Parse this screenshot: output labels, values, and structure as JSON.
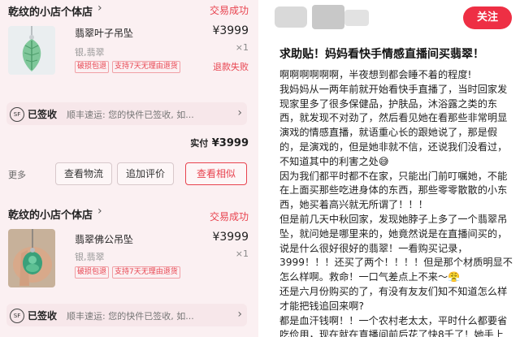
{
  "left_panel": {
    "orders": [
      {
        "shop_name": "乾纹的小店个体店",
        "status": "交易成功",
        "product_title": "翡翠叶子吊坠",
        "price": "¥3999",
        "qty": "×1",
        "spec": "银,翡翠",
        "badges": [
          "破损包退",
          "支持7天无理由退货"
        ],
        "refund_status": "退款失败",
        "logistics": {
          "icon": "SF",
          "signed_label": "已签收",
          "text": "顺丰速运: 您的快件已签收, 如..."
        },
        "paid_label": "实付",
        "paid_value": "¥3999",
        "more_label": "更多",
        "buttons": [
          "查看物流",
          "追加评价",
          "查看相似"
        ]
      },
      {
        "shop_name": "乾纹的小店个体店",
        "status": "交易成功",
        "product_title": "翡翠佛公吊坠",
        "price": "¥3999",
        "qty": "×1",
        "spec": "银,翡翠",
        "badges": [
          "破损包退",
          "支持7天无理由退货"
        ],
        "logistics": {
          "icon": "SF",
          "signed_label": "已签收",
          "text": "顺丰速运: 您的快件已签收, 如..."
        }
      }
    ]
  },
  "right_panel": {
    "follow_label": "关注",
    "post_title": "求助贴！妈妈看快手情感直播间买翡翠！",
    "paragraphs": [
      "啊啊啊啊啊啊，半夜想到都会睡不着的程度!",
      "我妈妈从一两年前就开始看快手直播了，当时回家发现家里多了很多保健品，护肤品，沐浴露之类的东西，就发现不对劲了，然后看见她在看那些非常明显演戏的情感直播，就语重心长的跟她说了，那是假的，是演戏的，但是她非就不信，还说我们没看过，不知道其中的利害之处",
      "因为我们都平时都不在家，只能出门前叮嘱她，不能在上面买那些吃进身体的东西，那些零零散散的小东西，她买着高兴就无所谓了！！！",
      "但是前几天中秋回家，发现她脖子上多了一个翡翠吊坠，就问她是哪里来的，她竟然说是在直播间买的，说是什么很好很好的翡翠！一看购买记录，3999！！！还买了两个！！！！但是那个材质明显不怎么样啊。救命！一口气差点上不来～",
      "还是六月份购买的了，有没有友友们知不知道怎么样才能把钱追回来啊?",
      "都是血汗钱啊！！一个农村老太太，平时什么都要省吃俭用，现在就在直播间前后花了快8千了！她手上"
    ]
  },
  "colors": {
    "accent": "#e8434f",
    "follow_bg": "#ee2f44",
    "left_bg": "#fbf0f2"
  }
}
